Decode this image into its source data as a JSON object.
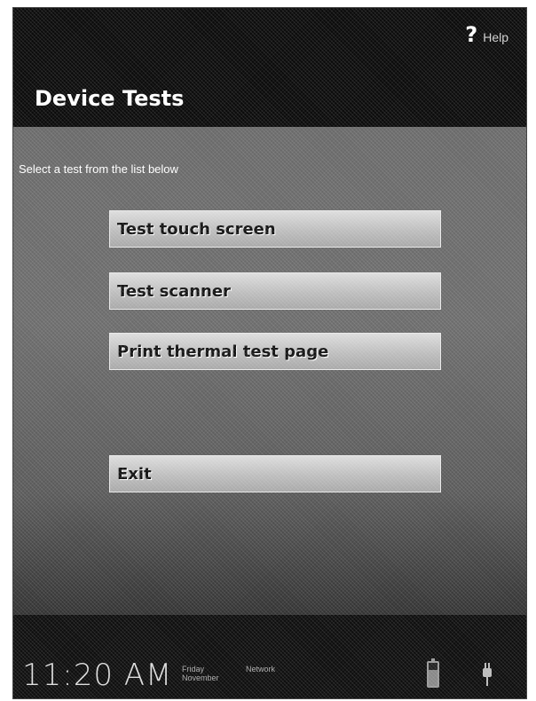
{
  "header": {
    "help_label": "Help",
    "help_icon": "question-mark-icon",
    "title": "Device Tests"
  },
  "main": {
    "instruction": "Select a test from the list below",
    "buttons": [
      {
        "label": "Test touch screen"
      },
      {
        "label": "Test scanner"
      },
      {
        "label": "Print thermal test page"
      }
    ],
    "exit_label": "Exit"
  },
  "status_bar": {
    "time": "11:20 AM",
    "date_line1": "Friday",
    "date_line2": "November",
    "network": "Network",
    "icons": [
      "battery-icon",
      "power-plug-icon"
    ]
  },
  "colors": {
    "background_dark": "#0b0b0b",
    "content_gray": "#6a6a6a",
    "button_face": "#c8c8c8",
    "text_white": "#ffffff"
  }
}
